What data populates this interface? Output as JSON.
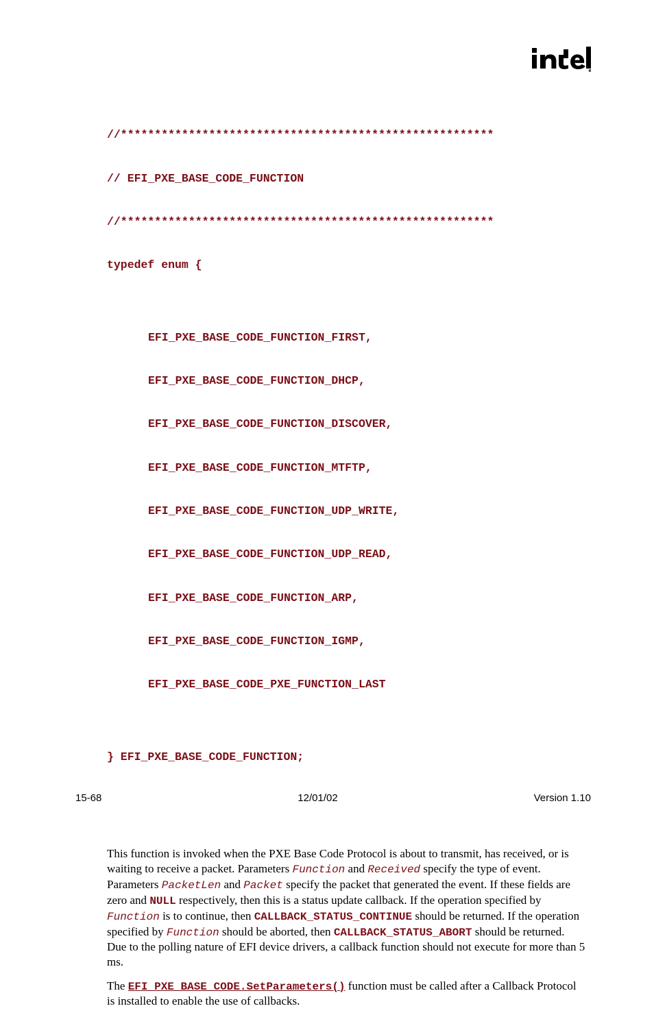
{
  "logo_text": "intel",
  "code": {
    "star_line": "//*******************************************************",
    "title_comment": "// EFI_PXE_BASE_CODE_FUNCTION",
    "typedef_open": "typedef enum {",
    "items": [
      "EFI_PXE_BASE_CODE_FUNCTION_FIRST,",
      "EFI_PXE_BASE_CODE_FUNCTION_DHCP,",
      "EFI_PXE_BASE_CODE_FUNCTION_DISCOVER,",
      "EFI_PXE_BASE_CODE_FUNCTION_MTFTP,",
      "EFI_PXE_BASE_CODE_FUNCTION_UDP_WRITE,",
      "EFI_PXE_BASE_CODE_FUNCTION_UDP_READ,",
      "EFI_PXE_BASE_CODE_FUNCTION_ARP,",
      "EFI_PXE_BASE_CODE_FUNCTION_IGMP,",
      "EFI_PXE_BASE_CODE_PXE_FUNCTION_LAST"
    ],
    "typedef_close": "} EFI_PXE_BASE_CODE_FUNCTION;"
  },
  "prose": {
    "p1_a": "This function is invoked when the PXE Base Code Protocol is about to transmit, has received, or is waiting to receive a packet.  Parameters ",
    "p1_fn": "Function",
    "p1_b": " and ",
    "p1_rcv": "Received",
    "p1_c": " specify the type of event.  Parameters ",
    "p1_pktlen": "PacketLen",
    "p1_d": " and ",
    "p1_pkt": "Packet",
    "p1_e": " specify the packet that generated the event.  If these fields are zero and ",
    "p1_null": "NULL",
    "p1_f": " respectively, then this is a status update callback.  If the operation specified by ",
    "p1_fn2": "Function",
    "p1_g": " is to continue, then ",
    "p1_cb_continue": "CALLBACK_STATUS_CONTINUE",
    "p1_h": " should be returned.  If the operation specified by ",
    "p1_fn3": "Function",
    "p1_i": " should be aborted, then ",
    "p1_cb_abort": "CALLBACK_STATUS_ABORT",
    "p1_j": " should be returned.  Due to the polling nature of EFI device drivers, a callback function should not execute for more than 5 ms.",
    "p2_a": "The ",
    "p2_link": "EFI_PXE_BASE_CODE.SetParameters()",
    "p2_b": " function must be called after a Callback Protocol is installed to enable the use of callbacks."
  },
  "footer": {
    "left": "15-68",
    "center": "12/01/02",
    "right": "Version 1.10"
  }
}
